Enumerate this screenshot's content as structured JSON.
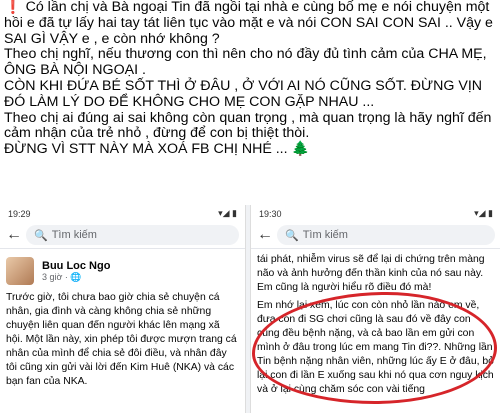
{
  "post": {
    "lines": [
      "❗ Có lần chị và Bà ngoại Tin đã ngồi tại nhà e cùng bố mẹ e nói chuyện một hồi e đã tự lấy hai tay tát liên tục vào mặt e và nói CON SAI CON SAI .. Vậy e SAI GÌ VẬY e , e còn nhớ không ?",
      "Theo chị nghĩ, nếu thương con thì nên cho nó đầy đủ tình cảm của CHA MẸ, ÔNG BÀ NỘI NGOẠI .",
      "CÒN KHI ĐỨA BÉ SỐT THÌ Ở ĐÂU , Ở VỚI AI NÓ CŨNG SỐT. ĐỪNG VỊN ĐÓ LÀM LÝ DO ĐỂ KHÔNG CHO MẸ CON GẶP NHAU ...",
      "Theo chị ai đúng ai sai không còn quan trọng , mà quan trọng là hãy nghĩ đến cảm nhận của trẻ nhỏ , đừng để con bị thiệt thòi.",
      "ĐỪNG VÌ STT NÀY MÀ XOÁ FB CHỊ NHÉ ..."
    ],
    "tree_icon": "🌲"
  },
  "left_screen": {
    "time": "19:29",
    "status_right": "▾◢ ▮",
    "search_placeholder": "Tìm kiếm",
    "author": "Buu Loc Ngo",
    "meta": "3 giờ · 🌐",
    "body": [
      "Trước giờ, tôi chưa bao giờ chia sẻ chuyện cá nhân, gia đình và càng không chia sẻ những chuyện liên quan đến người khác lên mạng xã hội. Một lần này, xin phép tôi được mượn trang cá nhân của mình để chia sẻ đôi điều, và nhân đây tôi cũng xin gửi vài lời đến Kim Huê (NKA) và các bạn fan của NKA."
    ]
  },
  "right_screen": {
    "time": "19:30",
    "status_right": "▾◢ ▮",
    "search_placeholder": "Tìm kiếm",
    "body_top": "tái phát, nhiễm virus sẽ để lại di chứng trên màng não và ảnh hưởng đến thần kinh của nó sau này. Em cũng là người hiểu rõ điều đó mà!",
    "body_circled": "Em nhớ lại xem, lúc con còn nhỏ lần nào em về, đưa con đi SG chơi cũng là sau đó về đây con cũng đều bệnh nặng, và cả bao lần em gửi con mình ở đâu trong lúc em mang Tin đi??. Những lần Tin bệnh nặng nhân viên, những lúc ấy E ở đâu, bỏ lại con đi lần E xuống sau khi nó qua cơn nguy kịch và ở lại cùng chăm sóc con vài tiếng"
  },
  "colors": {
    "highlight_circle": "#d6252a"
  }
}
